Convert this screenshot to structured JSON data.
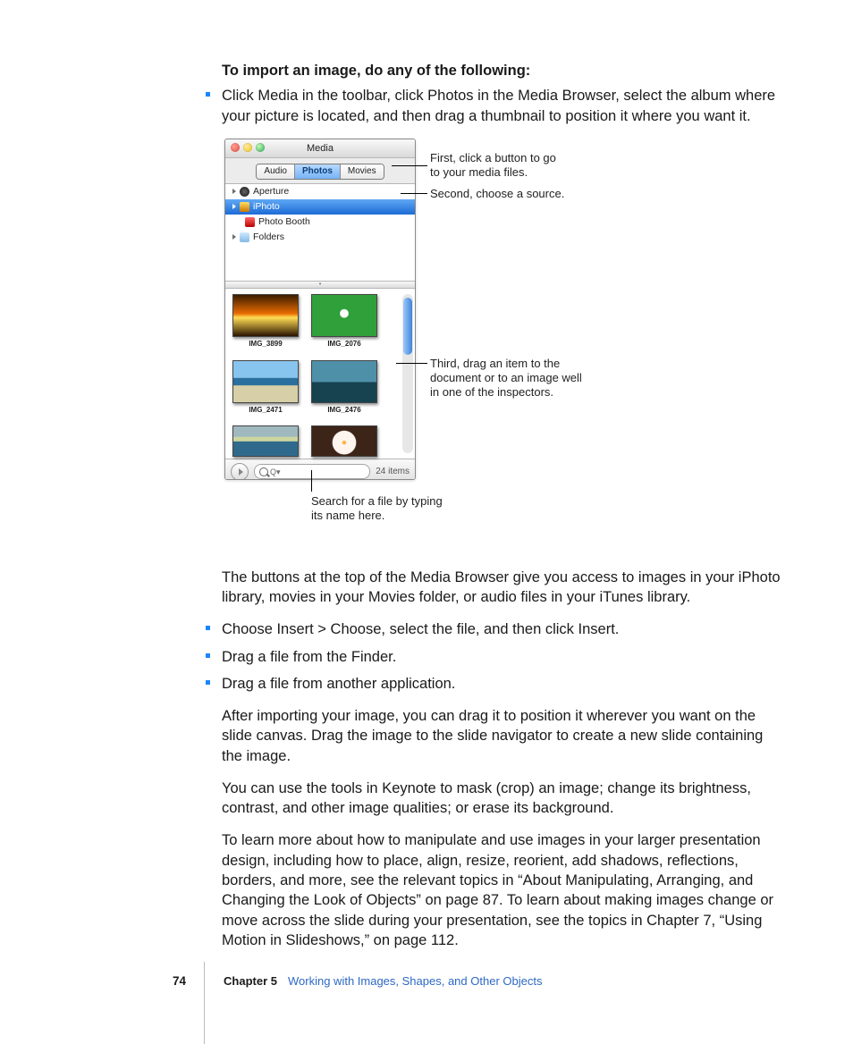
{
  "heading": "To import an image, do any of the following:",
  "bullets_top": [
    "Click Media in the toolbar, click Photos in the Media Browser, select the album where your picture is located, and then drag a thumbnail to position it where you want it."
  ],
  "media_browser": {
    "title": "Media",
    "tabs": {
      "audio": "Audio",
      "photos": "Photos",
      "movies": "Movies"
    },
    "sources": {
      "aperture": "Aperture",
      "iphoto": "iPhoto",
      "photo_booth": "Photo Booth",
      "folders": "Folders"
    },
    "thumbs": [
      {
        "label": "IMG_3899"
      },
      {
        "label": "IMG_2076"
      },
      {
        "label": "IMG_2471"
      },
      {
        "label": "IMG_2476"
      },
      {
        "label": ""
      },
      {
        "label": ""
      }
    ],
    "search_placeholder": "Q▾",
    "item_count": "24 items"
  },
  "callouts": {
    "tabs": "First, click a button to go to your media files.",
    "source": "Second, choose a source.",
    "drag": "Third, drag an item to the document or to an image well in one of the inspectors.",
    "search": "Search for a file by typing its name here."
  },
  "para_after_figure": "The buttons at the top of the Media Browser give you access to images in your iPhoto library, movies in your Movies folder, or audio files in your iTunes library.",
  "bullets_bottom": [
    "Choose Insert > Choose, select the file, and then click Insert.",
    "Drag a file from the Finder.",
    "Drag a file from another application."
  ],
  "para_after_bullets_1": "After importing your image, you can drag it to position it wherever you want on the slide canvas. Drag the image to the slide navigator to create a new slide containing the image.",
  "para_after_bullets_2": "You can use the tools in Keynote to mask (crop) an image; change its brightness, contrast, and other image qualities; or erase its background.",
  "para_after_bullets_3": "To learn more about how to manipulate and use images in your larger presentation design, including how to place, align, resize, reorient, add shadows, reflections, borders, and more, see the relevant topics in “About Manipulating, Arranging, and Changing the Look of Objects” on page 87. To learn about making images change or move across the slide during your presentation, see the topics in Chapter 7, “Using Motion in Slideshows,” on page 112.",
  "footer": {
    "page": "74",
    "chapter": "Chapter 5",
    "title": "Working with Images, Shapes, and Other Objects"
  }
}
